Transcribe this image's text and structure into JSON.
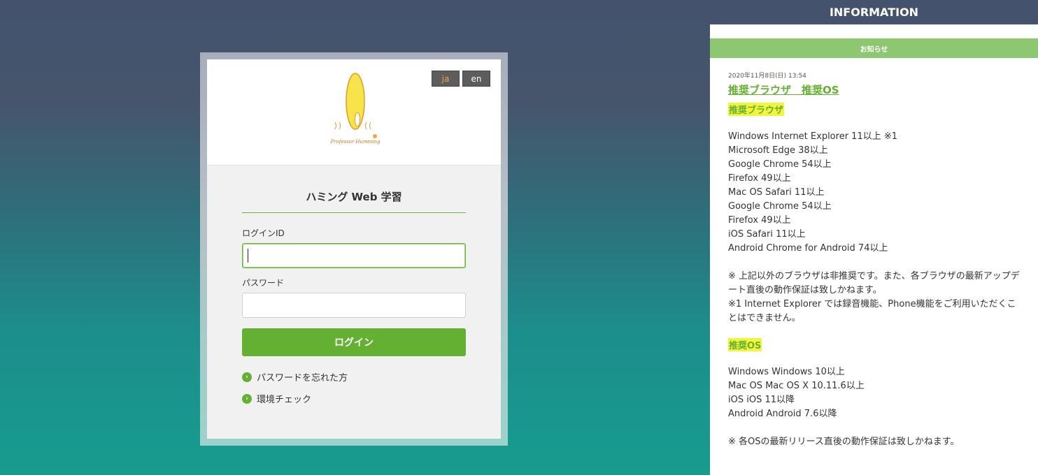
{
  "lang": {
    "ja": "ja",
    "en": "en"
  },
  "logo": {
    "text": "Professor Humming"
  },
  "login": {
    "title": "ハミング Web 学習",
    "id_label": "ログインID",
    "password_label": "パスワード",
    "login_button": "ログイン",
    "forgot_link": "パスワードを忘れた方",
    "env_link": "環境チェック"
  },
  "info": {
    "header": "INFORMATION",
    "subheader": "お知らせ",
    "date": "2020年11月8日(日) 13:54",
    "title": "推奨ブラウザ　推奨OS",
    "browser_heading": "推奨ブラウザ",
    "browsers": [
      "Windows Internet Explorer 11以上 ※1",
      "Microsoft Edge 38以上",
      "Google Chrome 54以上",
      "Firefox 49以上",
      "Mac OS Safari 11以上",
      "Google Chrome 54以上",
      "Firefox 49以上",
      "iOS Safari 11以上",
      "Android Chrome for Android 74以上"
    ],
    "browser_notes": [
      "※ 上記以外のブラウザは非推奨です。また、各ブラウザの最新アップデート直後の動作保証は致しかねます。",
      "※1 Internet Explorer では録音機能、Phone機能をご利用いただくことはできません。"
    ],
    "os_heading": "推奨OS",
    "os_list": [
      "Windows Windows 10以上",
      "Mac OS Mac OS X 10.11.6以上",
      "iOS iOS 11以降",
      "Android Android 7.6以降"
    ],
    "os_note": "※ 各OSの最新リリース直後の動作保証は致しかねます。"
  },
  "colors": {
    "accent": "#64b032",
    "header": "#45526d",
    "highlight": "#f2f53a"
  }
}
